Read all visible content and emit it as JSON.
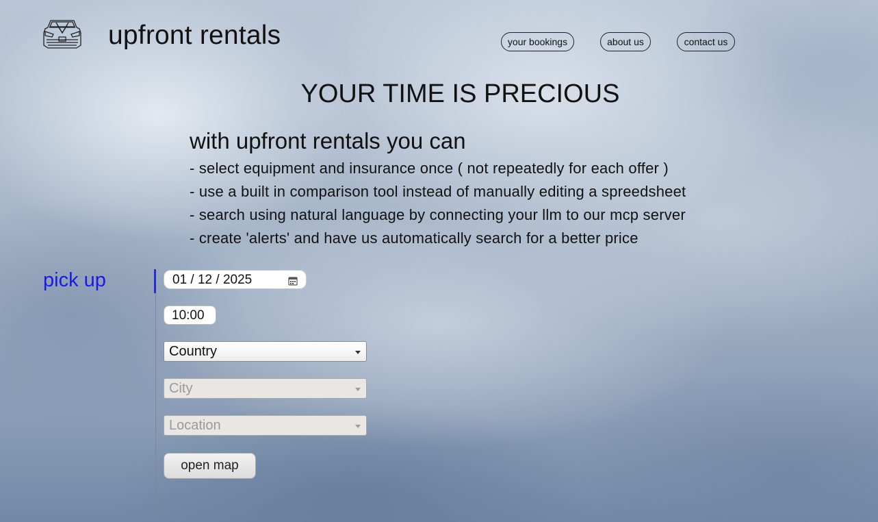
{
  "header": {
    "brand_name": "upfront rentals",
    "logo_icon": "car-front-icon",
    "nav": {
      "bookings": "your bookings",
      "about": "about us",
      "contact": "contact us"
    }
  },
  "hero": {
    "headline": "YOUR TIME IS PRECIOUS",
    "lead": "with upfront rentals you can",
    "features": [
      "- select equipment and insurance once ( not repeatedly for each offer )",
      "- use a built in comparison tool instead of manually editing a spreedsheet",
      "- search using natural language by connecting your llm to our mcp server",
      "- create 'alerts' and have us automatically search for a better price"
    ]
  },
  "pickup": {
    "label": "pick up",
    "date_value": "01 / 12 / 2025",
    "time_value": "10:00",
    "country_value": "Country",
    "city_value": "City",
    "location_value": "Location",
    "map_button": "open map"
  },
  "colors": {
    "section_label": "#1a1ae0",
    "active_indicator": "#2b2bd0"
  }
}
